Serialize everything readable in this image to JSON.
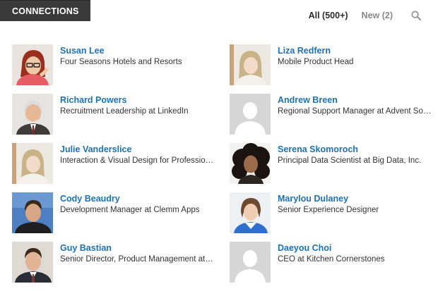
{
  "header": {
    "tab_label": "CONNECTIONS"
  },
  "filters": {
    "all_label": "All (500+)",
    "new_label": "New (2)"
  },
  "connections": [
    {
      "name": "Susan Lee",
      "title": "Four Seasons Hotels and Resorts"
    },
    {
      "name": "Liza Redfern",
      "title": "Mobile Product Head"
    },
    {
      "name": "Richard Powers",
      "title": "Recruitment Leadership at LinkedIn"
    },
    {
      "name": "Andrew Breen",
      "title": "Regional Support Manager at Advent Software"
    },
    {
      "name": "Julie Vanderslice",
      "title": "Interaction & Visual Design for Professional Services"
    },
    {
      "name": "Serena Skomoroch",
      "title": "Principal Data Scientist at Big Data, Inc."
    },
    {
      "name": "Cody Beaudry",
      "title": "Development Manager at Clemm Apps"
    },
    {
      "name": "Marylou Dulaney",
      "title": "Senior Experience Designer"
    },
    {
      "name": "Guy Bastian",
      "title": "Senior Director, Product Management at LinkedIn"
    },
    {
      "name": "Daeyou Choi",
      "title": "CEO at Kitchen Cornerstones"
    }
  ]
}
